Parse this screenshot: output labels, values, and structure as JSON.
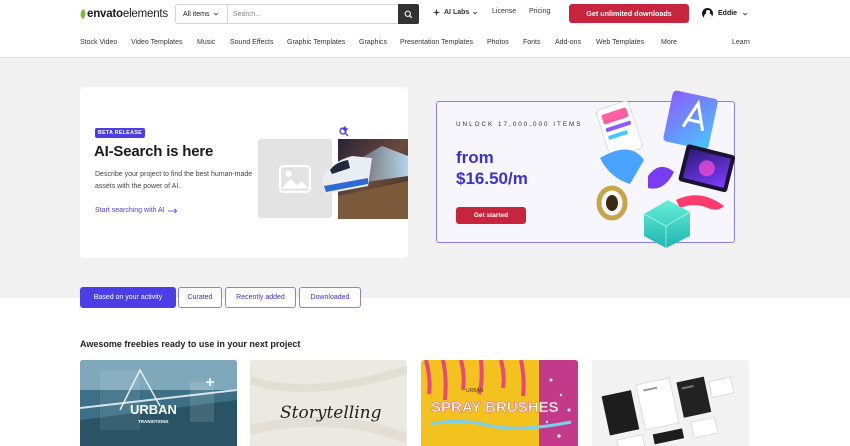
{
  "header": {
    "logo": {
      "part1": "envato",
      "part2": "elements"
    },
    "search": {
      "category": "All items",
      "placeholder": "Search..."
    },
    "ai_labs": "AI Labs",
    "license": "License",
    "pricing": "Pricing",
    "cta": "Get unlimited downloads",
    "user_name": "Eddie"
  },
  "categories": [
    "Stock Video",
    "Video Templates",
    "Music",
    "Sound Effects",
    "Graphic Templates",
    "Graphics",
    "Presentation Templates",
    "Photos",
    "Fonts",
    "Add-ons",
    "Web Templates",
    "More",
    "Learn"
  ],
  "ai_card": {
    "badge": "BETA RELEASE",
    "title": "AI-Search is here",
    "description": "Describe your project to find the best human-made assets with the power of AI.",
    "link": "Start searching with AI"
  },
  "promo": {
    "eyebrow": "UNLOCK 17,000,000 ITEMS",
    "price_line1": "from",
    "price_line2": "$16.50/m",
    "button": "Get started"
  },
  "tabs": [
    "Based on your activity",
    "Curated",
    "Recently added",
    "Downloaded"
  ],
  "section_title": "Awesome freebies ready to use in your next project",
  "thumbnails": [
    {
      "title": "URBAN",
      "subtitle": "TRANSITIONS"
    },
    {
      "title": "Storytelling"
    },
    {
      "title": "SPRAY BRUSHES",
      "subtitle": "URBAN"
    },
    {
      "title": ""
    }
  ],
  "colors": {
    "accent": "#4b3ee6",
    "cta": "#c7253e",
    "brand_green": "#82b440"
  }
}
